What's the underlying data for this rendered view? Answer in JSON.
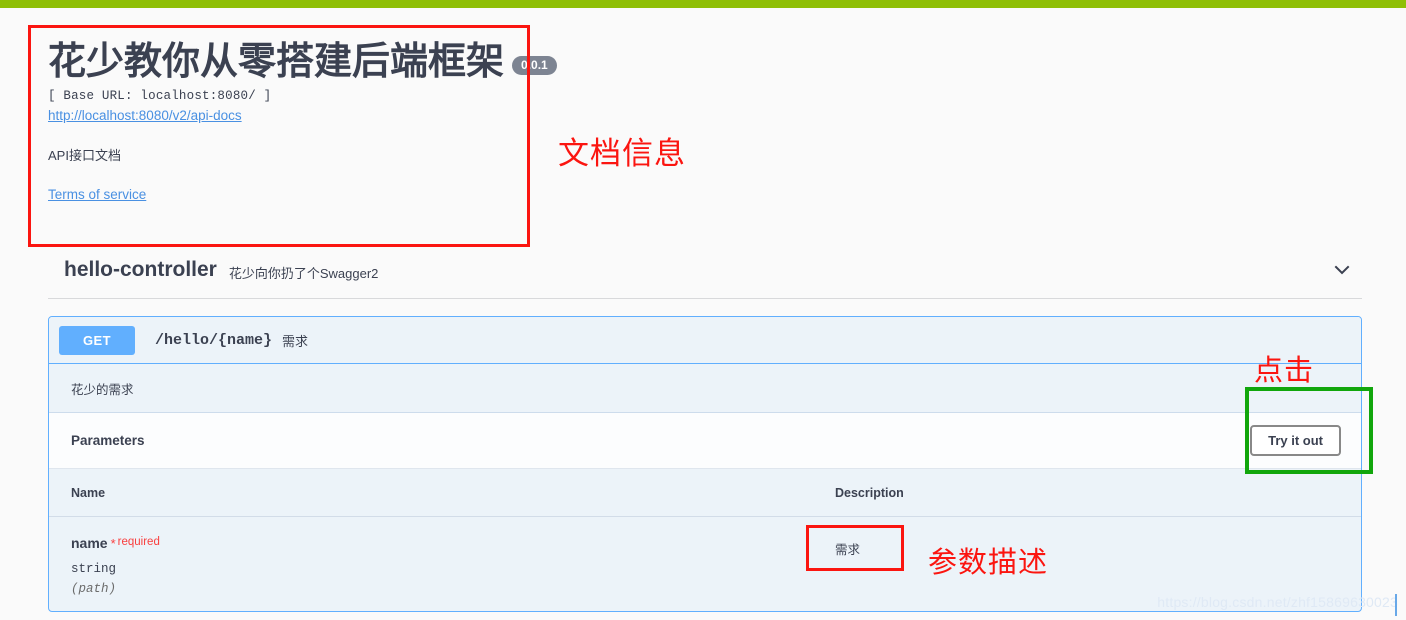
{
  "info": {
    "title": "花少教你从零搭建后端框架",
    "version_badge": "0.0.1",
    "base_url": "[ Base URL: localhost:8080/ ]",
    "docs_link": "http://localhost:8080/v2/api-docs",
    "description": "API接口文档",
    "terms_link": "Terms of service"
  },
  "annotations": {
    "doc_info": "文档信息",
    "click": "点击",
    "param_desc": "参数描述",
    "color_red": "#fb1510",
    "color_green": "#11a60c"
  },
  "tag": {
    "name": "hello-controller",
    "description": "花少向你扔了个Swagger2",
    "chevron_icon": "chevron-down-icon"
  },
  "operation": {
    "method": "GET",
    "method_color": "#61affe",
    "path": "/hello/{name}",
    "summary": "需求",
    "description": "花少的需求",
    "parameters_title": "Parameters",
    "try_it_out_label": "Try it out",
    "table": {
      "headers": [
        "Name",
        "Description"
      ],
      "rows": [
        {
          "name": "name",
          "required_star": "*",
          "required_label": "required",
          "type": "string",
          "in": "(path)",
          "description": "需求"
        }
      ]
    }
  },
  "watermark": {
    "text": "https://blog.csdn.net/zhf15869630023"
  },
  "theme": {
    "top_bar_color": "#8fbf06",
    "page_background": "#fafafa",
    "opblock_background": "#ecf3f9",
    "version_badge_color": "#7d8492"
  }
}
